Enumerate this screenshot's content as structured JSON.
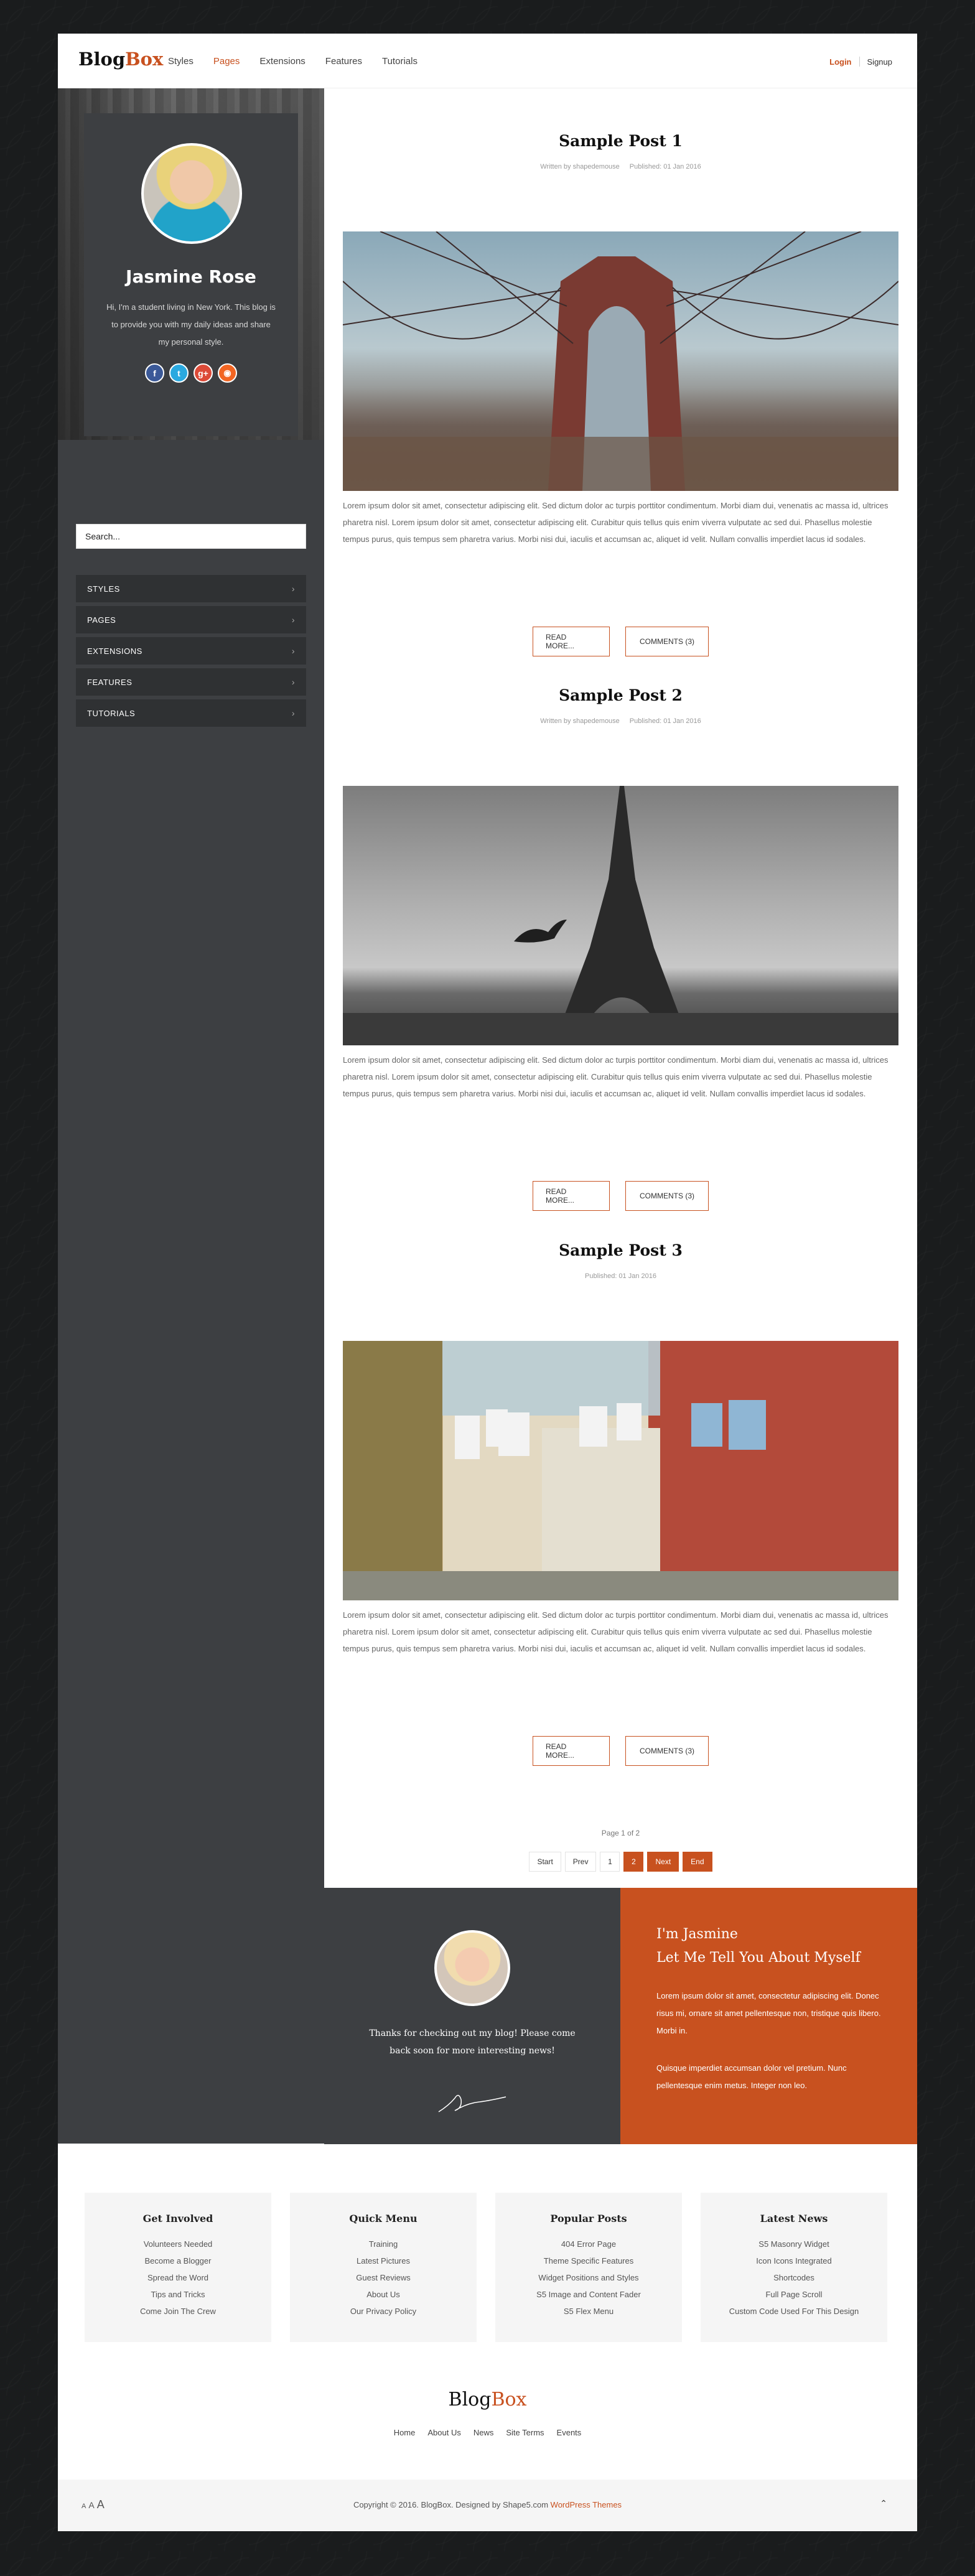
{
  "header": {
    "logo_main": "Blog",
    "logo_accent": "Box",
    "nav": [
      "Styles",
      "Pages",
      "Extensions",
      "Features",
      "Tutorials"
    ],
    "active_nav": "Pages",
    "login": "Login",
    "signup": "Signup"
  },
  "sidebar": {
    "name": "Jasmine Rose",
    "bio": "Hi, I'm a student living in New York. This blog is to provide you with my daily ideas and share my personal style.",
    "socials": [
      {
        "icon": "facebook-icon",
        "glyph": "f"
      },
      {
        "icon": "twitter-icon",
        "glyph": "t"
      },
      {
        "icon": "google-plus-icon",
        "glyph": "g+"
      },
      {
        "icon": "rss-icon",
        "glyph": "◉"
      }
    ],
    "search_value": "Search...",
    "menu": [
      "STYLES",
      "PAGES",
      "EXTENSIONS",
      "FEATURES",
      "TUTORIALS"
    ],
    "chevron": "›"
  },
  "posts": [
    {
      "title": "Sample Post 1",
      "author": "Written by shapedemouse",
      "published": "Published: 01 Jan 2016",
      "text": "Lorem ipsum dolor sit amet, consectetur adipiscing elit. Sed dictum dolor ac turpis porttitor condimentum. Morbi diam dui, venenatis ac massa id, ultrices pharetra nisl. Lorem ipsum dolor sit amet, consectetur adipiscing elit. Curabitur quis tellus quis enim viverra vulputate ac sed dui. Phasellus molestie tempus purus, quis tempus sem pharetra varius. Morbi nisi dui, iaculis et accumsan ac, aliquet id velit. Nullam convallis imperdiet lacus id sodales.",
      "read_more": "READ MORE...",
      "comments": "COMMENTS (3)"
    },
    {
      "title": "Sample Post 2",
      "author": "Written by shapedemouse",
      "published": "Published: 01 Jan 2016",
      "text": "Lorem ipsum dolor sit amet, consectetur adipiscing elit. Sed dictum dolor ac turpis porttitor condimentum. Morbi diam dui, venenatis ac massa id, ultrices pharetra nisl. Lorem ipsum dolor sit amet, consectetur adipiscing elit. Curabitur quis tellus quis enim viverra vulputate ac sed dui. Phasellus molestie tempus purus, quis tempus sem pharetra varius. Morbi nisi dui, iaculis et accumsan ac, aliquet id velit. Nullam convallis imperdiet lacus id sodales.",
      "read_more": "READ MORE...",
      "comments": "COMMENTS (3)"
    },
    {
      "title": "Sample Post 3",
      "published": "Published: 01 Jan 2016",
      "text": "Lorem ipsum dolor sit amet, consectetur adipiscing elit. Sed dictum dolor ac turpis porttitor condimentum. Morbi diam dui, venenatis ac massa id, ultrices pharetra nisl. Lorem ipsum dolor sit amet, consectetur adipiscing elit. Curabitur quis tellus quis enim viverra vulputate ac sed dui. Phasellus molestie tempus purus, quis tempus sem pharetra varius. Morbi nisi dui, iaculis et accumsan ac, aliquet id velit. Nullam convallis imperdiet lacus id sodales.",
      "read_more": "READ MORE...",
      "comments": "COMMENTS (3)"
    }
  ],
  "pagination": {
    "info": "Page 1 of 2",
    "start": "Start",
    "prev": "Prev",
    "page1": "1",
    "page2": "2",
    "next": "Next",
    "end": "End"
  },
  "about": {
    "thanks": "Thanks for checking out my blog! Please come back soon for more interesting news!",
    "heading1": "I'm Jasmine",
    "heading2": "Let Me Tell You About Myself",
    "para1": "Lorem ipsum dolor sit amet, consectetur adipiscing elit. Donec risus mi, ornare sit amet pellentesque non, tristique quis libero. Morbi in.",
    "para2": "Quisque imperdiet accumsan dolor vel pretium. Nunc pellentesque enim metus. Integer non leo."
  },
  "widgets": [
    {
      "title": "Get Involved",
      "items": [
        "Volunteers Needed",
        "Become a Blogger",
        "Spread the Word",
        "Tips and Tricks",
        "Come Join The Crew"
      ]
    },
    {
      "title": "Quick Menu",
      "items": [
        "Training",
        "Latest Pictures",
        "Guest Reviews",
        "About Us",
        "Our Privacy Policy"
      ]
    },
    {
      "title": "Popular Posts",
      "items": [
        "404 Error Page",
        "Theme Specific Features",
        "Widget Positions and Styles",
        "S5 Image and Content Fader",
        "S5 Flex Menu"
      ]
    },
    {
      "title": "Latest News",
      "items": [
        "S5 Masonry Widget",
        "Icon Icons Integrated",
        "Shortcodes",
        "Full Page Scroll",
        "Custom Code Used For This Design"
      ]
    }
  ],
  "footer": {
    "logo_main": "Blog",
    "logo_accent": "Box",
    "nav": [
      "Home",
      "About Us",
      "News",
      "Site Terms",
      "Events"
    ],
    "font_small": "A",
    "font_mid": "A",
    "font_large": "A",
    "copyright": "Copyright © 2016. BlogBox. Designed by Shape5.com ",
    "copyright_link": "WordPress Themes",
    "to_top": "⌃"
  },
  "colors": {
    "accent": "#c8511f",
    "sidebar": "#3d3f42",
    "background": "#1a1c1d"
  }
}
